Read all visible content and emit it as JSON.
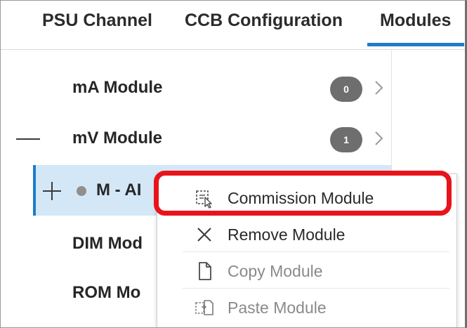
{
  "tabs": [
    {
      "label": "PSU Channel"
    },
    {
      "label": "CCB Configuration"
    },
    {
      "label": "Modules"
    }
  ],
  "modules": [
    {
      "label": "mA Module",
      "count": "0"
    },
    {
      "label": "mV Module",
      "count": "1"
    },
    {
      "label": "M - AI"
    },
    {
      "label": "DIM Mod"
    },
    {
      "label": "ROM Mo"
    }
  ],
  "context_menu": {
    "items": [
      {
        "label": "Commission Module",
        "icon": "commission-icon"
      },
      {
        "label": "Remove Module",
        "icon": "close-icon"
      },
      {
        "label": "Copy Module",
        "icon": "document-icon"
      },
      {
        "label": "Paste Module",
        "icon": "paste-icon"
      }
    ]
  },
  "colors": {
    "accent": "#1f7bc6",
    "selected_row": "#d4e7f7",
    "highlight": "#e8131b",
    "badge": "#6e6e6e"
  }
}
